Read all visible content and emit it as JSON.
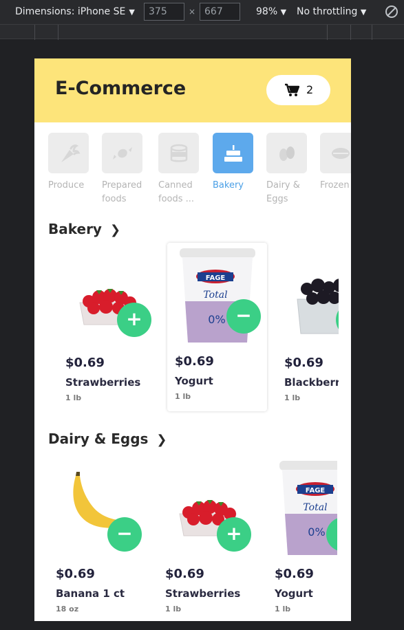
{
  "devtools": {
    "device": "Dimensions: iPhone SE",
    "width": "375",
    "height": "667",
    "zoom": "98%",
    "throttling": "No throttling"
  },
  "app": {
    "title": "E-Commerce",
    "cart_count": "2",
    "accent": "#fde47a",
    "active_color": "#5da9ec",
    "button_color": "#3bcf86"
  },
  "categories": [
    {
      "label": "Produce",
      "icon": "carrot-icon"
    },
    {
      "label": "Prepared foods",
      "icon": "candy-icon"
    },
    {
      "label": "Canned foods ...",
      "icon": "can-icon"
    },
    {
      "label": "Bakery",
      "icon": "cake-icon",
      "active": true
    },
    {
      "label": "Dairy & Eggs",
      "icon": "egg-icon"
    },
    {
      "label": "Frozen",
      "icon": "frozen-icon"
    }
  ],
  "sections": [
    {
      "title": "Bakery",
      "products": [
        {
          "price": "$0.69",
          "name": "Strawberries",
          "unit": "1 lb",
          "action": "+"
        },
        {
          "price": "$0.69",
          "name": "Yogurt",
          "unit": "1 lb",
          "action": "−"
        },
        {
          "price": "$0.69",
          "name": "Blackberries",
          "unit": "1 lb",
          "action": "+"
        }
      ]
    },
    {
      "title": "Dairy & Eggs",
      "products": [
        {
          "price": "$0.69",
          "name": "Banana 1 ct",
          "unit": "18 oz",
          "action": "−"
        },
        {
          "price": "$0.69",
          "name": "Strawberries",
          "unit": "1 lb",
          "action": "+"
        },
        {
          "price": "$0.69",
          "name": "Yogurt",
          "unit": "1 lb",
          "action": "+"
        }
      ]
    }
  ],
  "yogurt_brand": "FAGE",
  "yogurt_sub": "Total",
  "yogurt_fat": "0%"
}
